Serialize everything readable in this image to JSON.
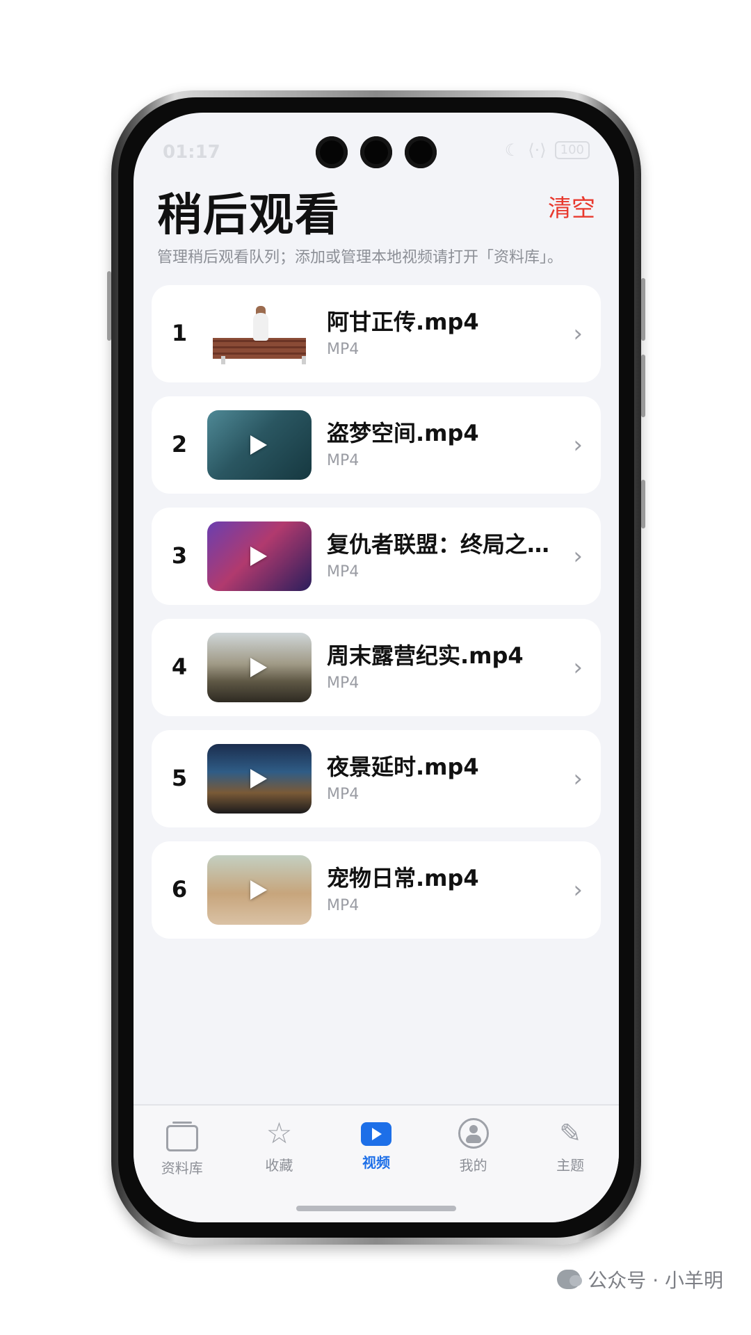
{
  "status_bar": {
    "time": "01:17",
    "battery": "100"
  },
  "header": {
    "title": "稍后观看",
    "clear_label": "清空",
    "subtitle": "管理稍后观看队列；添加或管理本地视频请打开「资料库」。"
  },
  "list": [
    {
      "index": "1",
      "name": "阿甘正传.mp4",
      "format": "MP4"
    },
    {
      "index": "2",
      "name": "盗梦空间.mp4",
      "format": "MP4"
    },
    {
      "index": "3",
      "name": "复仇者联盟：终局之…",
      "format": "MP4"
    },
    {
      "index": "4",
      "name": "周末露营纪实.mp4",
      "format": "MP4"
    },
    {
      "index": "5",
      "name": "夜景延时.mp4",
      "format": "MP4"
    },
    {
      "index": "6",
      "name": "宠物日常.mp4",
      "format": "MP4"
    }
  ],
  "chevron": "›",
  "nav": [
    {
      "label": "资料库",
      "icon": "library-icon"
    },
    {
      "label": "收藏",
      "icon": "star-icon"
    },
    {
      "label": "视频",
      "icon": "video-icon",
      "active": true
    },
    {
      "label": "我的",
      "icon": "profile-icon"
    },
    {
      "label": "主题",
      "icon": "brush-icon"
    }
  ],
  "watermark": "公众号 · 小羊明",
  "colors": {
    "accent": "#1d6fe8",
    "clear": "#e8392e",
    "background": "#f3f4f8"
  }
}
